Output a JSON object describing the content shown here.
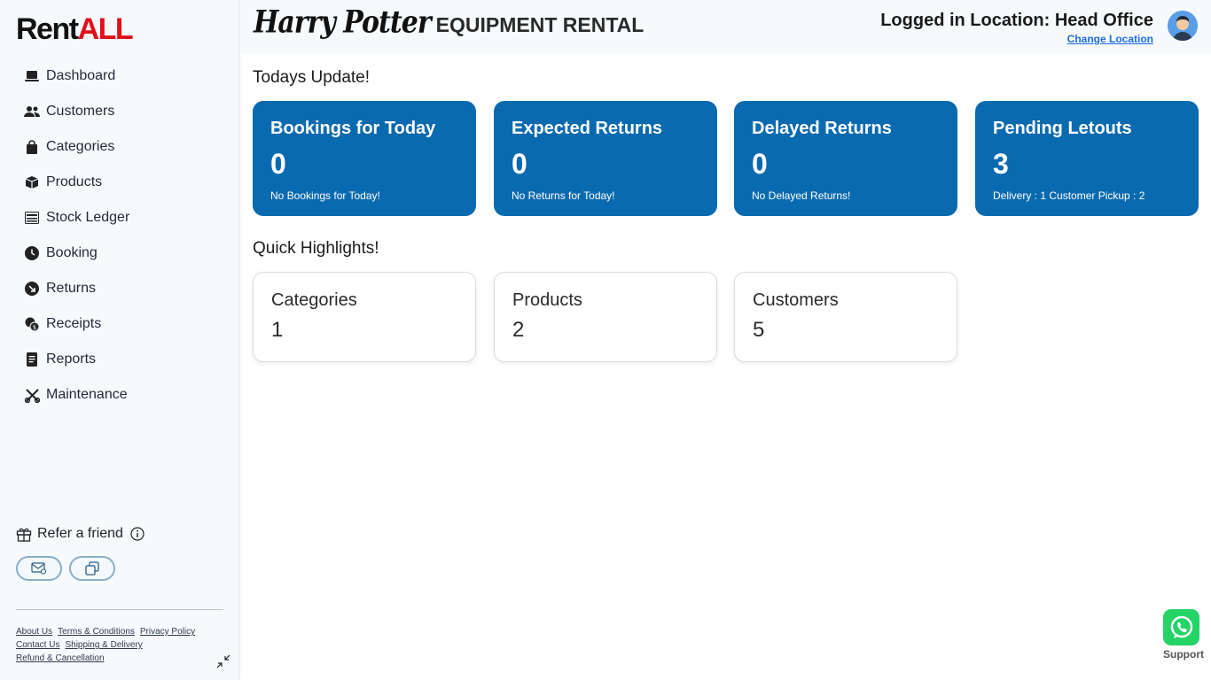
{
  "logo": {
    "part1": "Rent",
    "part2": "ALL",
    "accent": "#e0101a"
  },
  "sidebar": {
    "items": [
      {
        "label": "Dashboard",
        "icon": "laptop-icon"
      },
      {
        "label": "Customers",
        "icon": "users-icon"
      },
      {
        "label": "Categories",
        "icon": "bag-icon"
      },
      {
        "label": "Products",
        "icon": "box-icon"
      },
      {
        "label": "Stock Ledger",
        "icon": "ledger-icon"
      },
      {
        "label": "Booking",
        "icon": "clock-icon"
      },
      {
        "label": "Returns",
        "icon": "return-arrow-icon"
      },
      {
        "label": "Receipts",
        "icon": "coins-icon"
      },
      {
        "label": "Reports",
        "icon": "document-icon"
      },
      {
        "label": "Maintenance",
        "icon": "tools-icon"
      }
    ],
    "refer": {
      "label": "Refer a friend"
    },
    "footer_links": {
      "about": "About Us",
      "terms": "Terms & Conditions",
      "privacy": "Privacy Policy",
      "contact": "Contact Us",
      "shipping": "Shipping & Delivery",
      "refund": "Refund & Cancellation"
    }
  },
  "header": {
    "brand_logo_text": "Harry Potter",
    "title": "EQUIPMENT RENTAL",
    "location_label": "Logged in Location: Head Office",
    "change_location": "Change Location"
  },
  "today": {
    "title": "Todays Update!",
    "cards": [
      {
        "title": "Bookings for Today",
        "value": "0",
        "sub": "No Bookings for Today!"
      },
      {
        "title": "Expected Returns",
        "value": "0",
        "sub": "No Returns for Today!"
      },
      {
        "title": "Delayed Returns",
        "value": "0",
        "sub": "No Delayed Returns!"
      },
      {
        "title": "Pending Letouts",
        "value": "3",
        "sub": "Delivery : 1 Customer Pickup : 2"
      }
    ]
  },
  "highlights": {
    "title": "Quick Highlights!",
    "cards": [
      {
        "title": "Categories",
        "value": "1"
      },
      {
        "title": "Products",
        "value": "2"
      },
      {
        "title": "Customers",
        "value": "5"
      }
    ]
  },
  "support": {
    "label": "Support"
  },
  "colors": {
    "card_blue": "#0a6aaf",
    "link_blue": "#1a6fe0",
    "whatsapp_green": "#25d366"
  }
}
